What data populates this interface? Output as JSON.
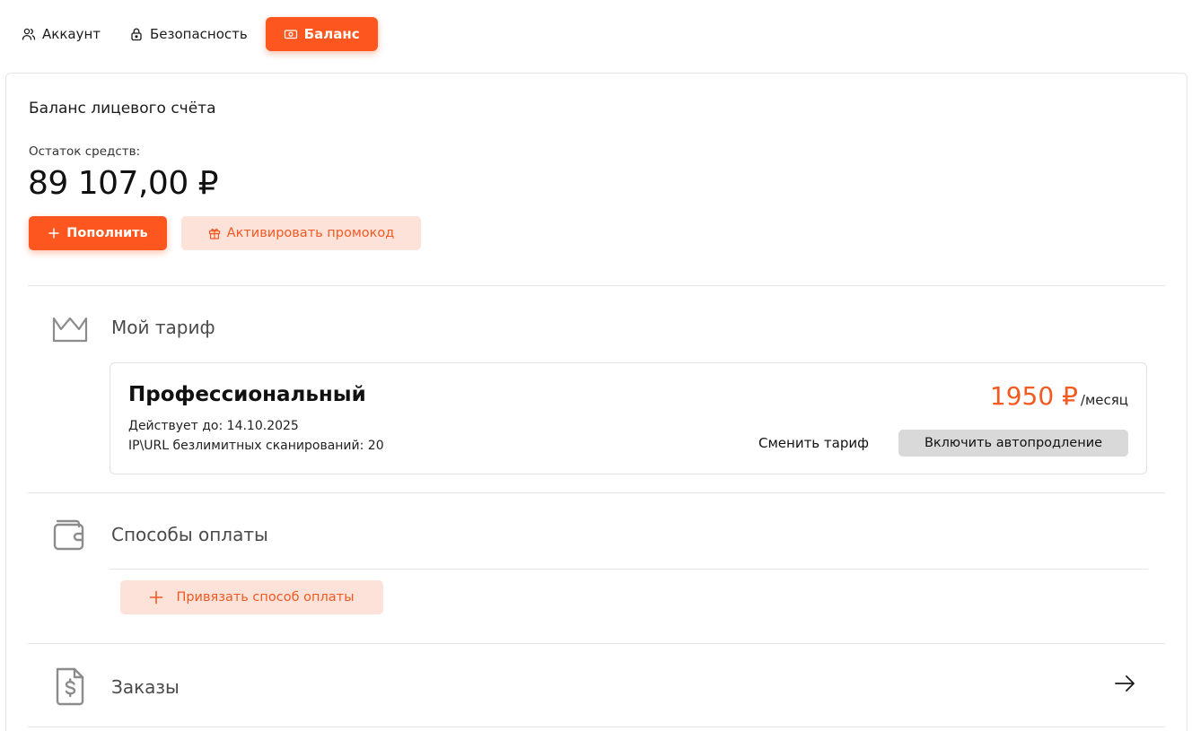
{
  "tabs": [
    {
      "label": "Аккаунт",
      "icon": "users-icon",
      "active": false
    },
    {
      "label": "Безопасность",
      "icon": "lock-icon",
      "active": false
    },
    {
      "label": "Баланс",
      "icon": "cash-icon",
      "active": true
    }
  ],
  "balance": {
    "title": "Баланс лицевого счёта",
    "remaining_label": "Остаток средств:",
    "amount": "89 107,00 ₽",
    "topup_label": "Пополнить",
    "promo_label": "Активировать промокод"
  },
  "tariff": {
    "section_title": "Мой тариф",
    "name": "Профессиональный",
    "valid_until": "Действует до: 14.10.2025",
    "scans": "IP\\URL безлимитных сканирований: 20",
    "price": "1950 ₽",
    "price_unit": "/месяц",
    "change_label": "Сменить тариф",
    "autorenew_label": "Включить автопродление"
  },
  "payment": {
    "section_title": "Способы оплаты",
    "add_label": "Привязать способ оплаты"
  },
  "orders": {
    "section_title": "Заказы"
  },
  "colors": {
    "accent": "#fd561e",
    "accent_soft": "#fde2d9",
    "gray_button": "#d9d9d9"
  }
}
